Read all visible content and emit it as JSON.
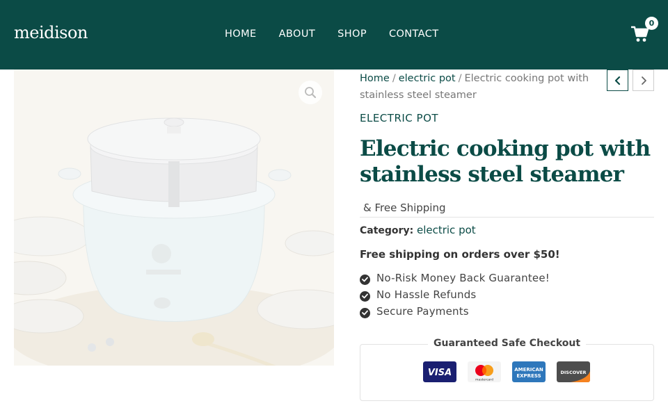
{
  "header": {
    "logo": "meidison",
    "nav": [
      {
        "label": "HOME"
      },
      {
        "label": "ABOUT"
      },
      {
        "label": "SHOP"
      },
      {
        "label": "CONTACT"
      }
    ],
    "cart_count": "0",
    "cart_icon": "shopping-cart-icon",
    "background_color": "#0b4b46"
  },
  "gallery": {
    "zoom_icon": "magnifier-icon"
  },
  "breadcrumb": {
    "home": "Home",
    "separator": "/",
    "category": "electric pot",
    "current": "Electric cooking pot with stainless steel steamer"
  },
  "product": {
    "category_label": "ELECTRIC POT",
    "title": "Electric cooking pot with stainless steel steamer",
    "shipping_note": "& Free Shipping",
    "category_key": "Category:",
    "category_value": "electric pot",
    "free_shipping": "Free shipping on orders over $50!",
    "features": [
      "No-Risk Money Back Guarantee!",
      "No Hassle Refunds",
      "Secure Payments"
    ]
  },
  "checkout": {
    "legend": "Guaranteed Safe Checkout",
    "visa": "VISA",
    "mastercard": "mastercard",
    "amex_1": "AMERICAN",
    "amex_2": "EXPRESS",
    "discover": "DISCOVER"
  },
  "colors": {
    "accent": "#0b4b46",
    "visa": "#1a1f71",
    "amex": "#2e77bb",
    "discover": "#f58220"
  }
}
